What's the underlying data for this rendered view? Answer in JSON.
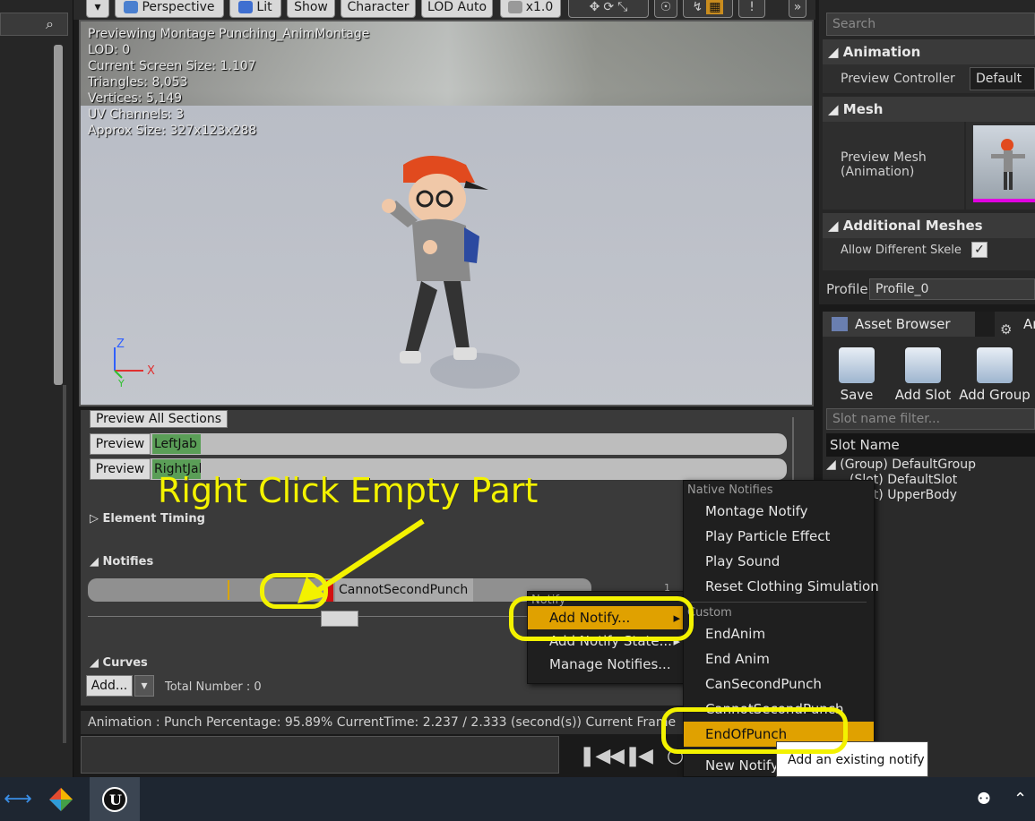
{
  "toolbar": {
    "buttons": [
      "Perspective",
      "Lit",
      "Show",
      "Character",
      "LOD Auto",
      "x1.0"
    ]
  },
  "viewport": {
    "info_lines": [
      "Previewing Montage Punching_AnimMontage",
      "LOD: 0",
      "Current Screen Size: 1.107",
      "Triangles: 8,053",
      "Vertices: 5,149",
      "UV Channels: 3",
      "Approx Size: 327x123x288"
    ],
    "axis_z": "Z",
    "axis_x": "X",
    "axis_y": "Y"
  },
  "montage": {
    "preview_all": "Preview All Sections",
    "preview_label": "Preview",
    "sections": [
      "LeftJab",
      "RightJab"
    ],
    "element_timing": "Element Timing",
    "notifies": "Notifies",
    "notify_name": "CannotSecondPunch",
    "track_number": "1",
    "curves": "Curves",
    "add_button": "Add...",
    "total_number": "Total Number : 0"
  },
  "status": {
    "text": "Animation :  Punch  Percentage:  95.89%  CurrentTime:  2.237 / 2.333 (second(s))  Current Frame"
  },
  "details": {
    "search_placeholder": "Search",
    "animation_header": "Animation",
    "preview_controller_label": "Preview Controller",
    "preview_controller_value": "Default",
    "mesh_header": "Mesh",
    "preview_mesh_label_1": "Preview Mesh",
    "preview_mesh_label_2": "(Animation)",
    "additional_meshes_header": "Additional Meshes",
    "allow_different_label": "Allow Different Skele",
    "profile_label": "Profile",
    "profile_value": "Profile_0"
  },
  "asset_panel": {
    "tab_asset_browser": "Asset Browser",
    "tab_second": "An",
    "tools": [
      "Save",
      "Add Slot",
      "Add Group"
    ],
    "slot_filter_placeholder": "Slot name filter...",
    "slot_header": "Slot Name",
    "slots": [
      "(Group) DefaultGroup",
      "(Slot) DefaultSlot",
      "(Slot) UpperBody"
    ]
  },
  "context_menu": {
    "section": "Notify",
    "items": [
      "Add Notify...",
      "Add Notify State...",
      "Manage Notifies..."
    ]
  },
  "submenu": {
    "native_section": "Native Notifies",
    "native_items": [
      "Montage Notify",
      "Play Particle Effect",
      "Play Sound",
      "Reset Clothing Simulation"
    ],
    "custom_section": "Custom",
    "custom_items": [
      "EndAnim",
      "End Anim",
      "CanSecondPunch",
      "CannotSecondPunch",
      "EndOfPunch"
    ],
    "new_notify": "New Notify",
    "tooltip": "Add an existing notify"
  },
  "annotation": {
    "text": "Right Click Empty Part"
  },
  "colors": {
    "accent": "#e0a100",
    "annotation": "#f3f200"
  }
}
